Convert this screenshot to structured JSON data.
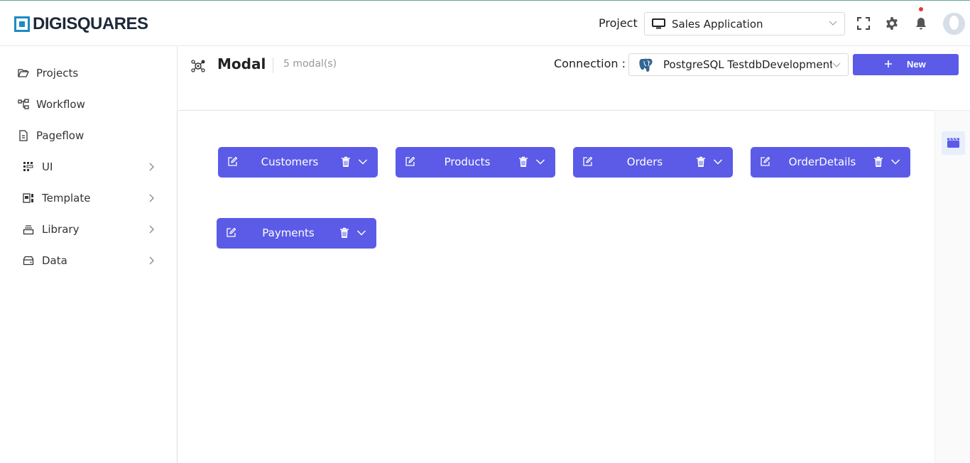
{
  "app": {
    "logo_text": "DIGISQUARES"
  },
  "header": {
    "project_label": "Project",
    "project_value": "Sales Application",
    "icons": [
      "monitor-icon",
      "fullscreen-icon",
      "gear-icon",
      "bell-icon",
      "avatar"
    ]
  },
  "sidebar": {
    "items": [
      {
        "label": "Projects",
        "icon": "folder-open-icon",
        "has_arrow": false
      },
      {
        "label": "Workflow",
        "icon": "workflow-icon",
        "has_arrow": false
      },
      {
        "label": "Pageflow",
        "icon": "pageflow-icon",
        "has_arrow": false
      },
      {
        "label": "UI",
        "icon": "ui-grid-icon",
        "has_arrow": true
      },
      {
        "label": "Template",
        "icon": "template-icon",
        "has_arrow": true
      },
      {
        "label": "Library",
        "icon": "library-icon",
        "has_arrow": true
      },
      {
        "label": "Data",
        "icon": "data-icon",
        "has_arrow": true
      }
    ]
  },
  "main": {
    "title": "Modal",
    "count": "5 modal(s)",
    "connection_label": "Connection :",
    "connection_value": "PostgreSQL TestdbDevelopment",
    "new_button": "New",
    "modals": [
      {
        "name": "Customers"
      },
      {
        "name": "Products"
      },
      {
        "name": "Orders"
      },
      {
        "name": "OrderDetails"
      },
      {
        "name": "Payments"
      }
    ]
  },
  "colors": {
    "accent": "#5b5be8",
    "logo": "#1e8bc3",
    "notification": "#e53935"
  }
}
